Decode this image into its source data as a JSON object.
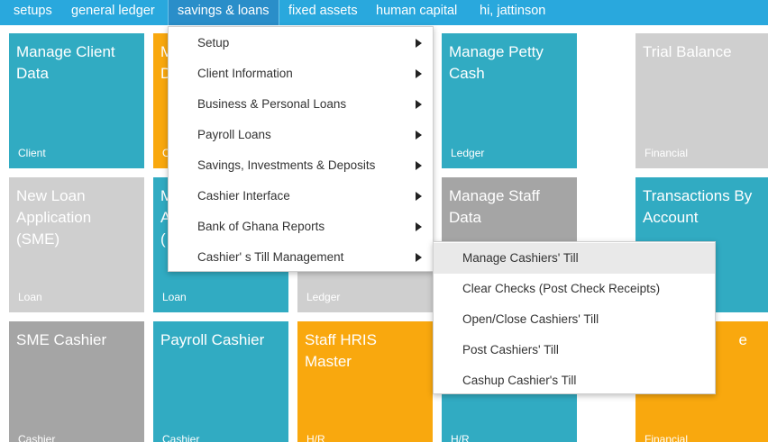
{
  "nav": {
    "items": [
      {
        "label": "setups"
      },
      {
        "label": "general ledger"
      },
      {
        "label": "savings & loans"
      },
      {
        "label": "fixed assets"
      },
      {
        "label": "human capital"
      },
      {
        "label": "hi, jattinson"
      }
    ]
  },
  "tiles": [
    {
      "title": "Manage Client Data",
      "tag": "Client",
      "color": "#31abc2"
    },
    {
      "title": "M\nD",
      "tag": "C",
      "color": "#f9a80e"
    },
    {
      "title": "Manage Petty Cash",
      "tag": "Ledger",
      "color": "#31abc2"
    },
    {
      "title": "Trial Balance",
      "tag": "Financial",
      "color": "#cfcfcf"
    },
    {
      "title": "New Loan Application (SME)",
      "tag": "Loan",
      "color": "#cfcfcf"
    },
    {
      "title": "M\nA\n(",
      "tag": "Loan",
      "color": "#31abc2"
    },
    {
      "title": "",
      "tag": "Ledger",
      "color": "#cfcfcf"
    },
    {
      "title": "Manage Staff Data",
      "tag": "",
      "color": "#a5a5a5"
    },
    {
      "title": "Transactions By Account",
      "tag": "",
      "color": "#31abc2"
    },
    {
      "title": "SME Cashier",
      "tag": "Cashier",
      "color": "#a5a5a5"
    },
    {
      "title": "Payroll Cashier",
      "tag": "Cashier",
      "color": "#31abc2"
    },
    {
      "title": "Staff HRIS Master",
      "tag": "H/R",
      "color": "#f9a80e"
    },
    {
      "title": "",
      "tag": "H/R",
      "color": "#31abc2"
    },
    {
      "title": "e",
      "tag": "Financial",
      "color": "#f9a80e"
    }
  ],
  "menu": {
    "items": [
      {
        "label": "Setup"
      },
      {
        "label": "Client Information"
      },
      {
        "label": "Business & Personal Loans"
      },
      {
        "label": "Payroll Loans"
      },
      {
        "label": "Savings, Investments & Deposits"
      },
      {
        "label": "Cashier Interface"
      },
      {
        "label": "Bank of Ghana Reports"
      },
      {
        "label": "Cashier' s Till Management"
      }
    ]
  },
  "submenu": {
    "items": [
      {
        "label": "Manage Cashiers' Till"
      },
      {
        "label": "Clear Checks (Post Check Receipts)"
      },
      {
        "label": "Open/Close Cashiers' Till"
      },
      {
        "label": "Post Cashiers' Till"
      },
      {
        "label": "Cashup Cashier's Till"
      }
    ]
  }
}
